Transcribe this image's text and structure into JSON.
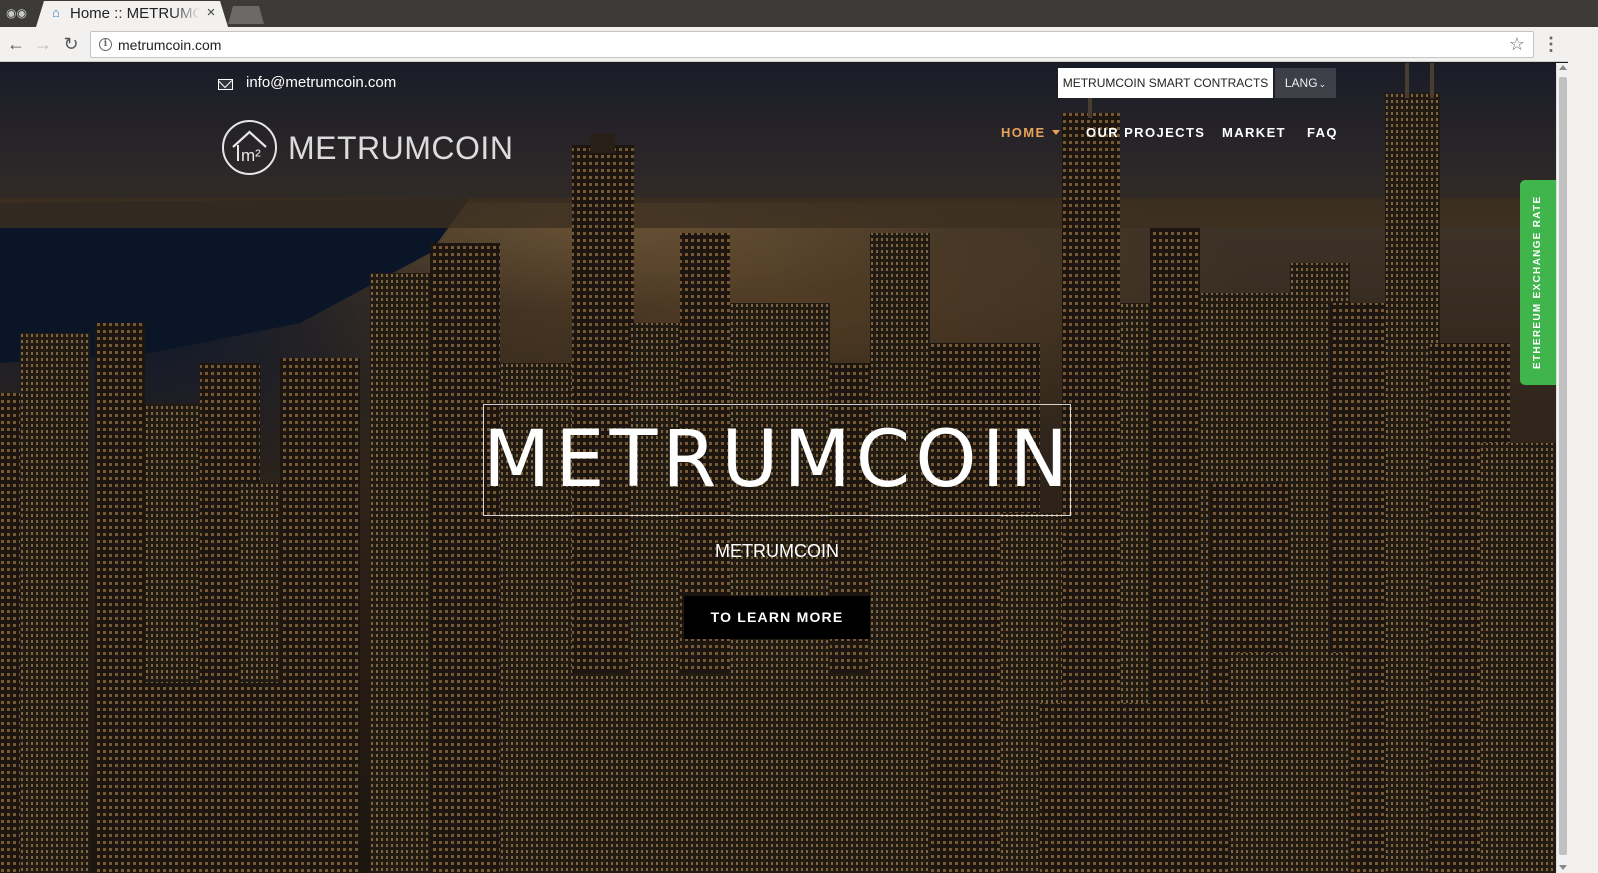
{
  "browser": {
    "tab_title": "Home :: METRUMCOIN",
    "tab_close": "×",
    "url": "metrumcoin.com",
    "icons": {
      "incognito": "incognito-icon",
      "back": "back-arrow-icon",
      "forward": "forward-arrow-icon",
      "reload": "reload-icon",
      "info": "info-icon",
      "star": "bookmark-star-icon",
      "menu": "kebab-menu-icon"
    }
  },
  "topbar": {
    "email": "info@metrumcoin.com",
    "contracts_button": "METRUMCOIN SMART CONTRACTS",
    "lang_button": "LANG"
  },
  "brand": {
    "logo_text": "METRUMCOIN",
    "logo_mark_text": "m²"
  },
  "nav": {
    "items": [
      "HOME",
      "OUR PROJECTS",
      "MARKET",
      "FAQ"
    ],
    "active_index": 0
  },
  "hero": {
    "title": "METRUMCOIN",
    "subtitle": "METRUMCOIN",
    "cta": "TO LEARN MORE"
  },
  "side_widget": {
    "label": "ETHEREUM EXCHANGE RATE"
  },
  "colors": {
    "accent": "#e8a25a",
    "side_widget": "#3fb54b",
    "cta_bg": "#000000",
    "chrome_bg": "#3c3b37"
  }
}
